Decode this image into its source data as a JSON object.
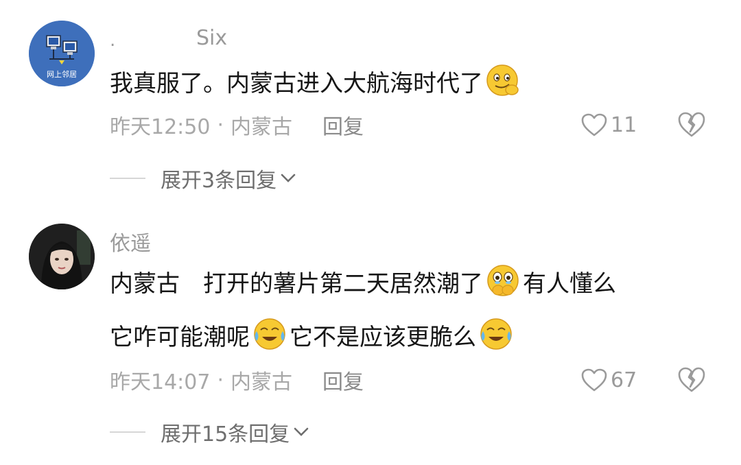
{
  "comments": [
    {
      "username_prefix": ".",
      "username": "Six",
      "avatar_label": "网上邻居",
      "text_line1": "我真服了。内蒙古进入大航海时代了",
      "emoji_after_line1": "smirk-hand-emoji",
      "time": "昨天12:50",
      "location": "内蒙古",
      "reply_label": "回复",
      "likes": "11",
      "expand_label": "展开3条回复"
    },
    {
      "username": "依遥",
      "text_line1_a": "内蒙古",
      "text_line1_b": "打开的薯片第二天居然潮了",
      "text_line1_c": "有人懂么",
      "text_line2_a": "它咋可能潮呢",
      "text_line2_b": "它不是应该更脆么",
      "time": "昨天14:07",
      "location": "内蒙古",
      "reply_label": "回复",
      "likes": "67",
      "expand_label": "展开15条回复"
    }
  ],
  "separator": "·",
  "colors": {
    "text": "#161616",
    "meta": "#a8a8a8",
    "username": "#9a9a9a",
    "emoji_yellow": "#f7c932",
    "avatar1_bg": "#3e6fbb"
  }
}
